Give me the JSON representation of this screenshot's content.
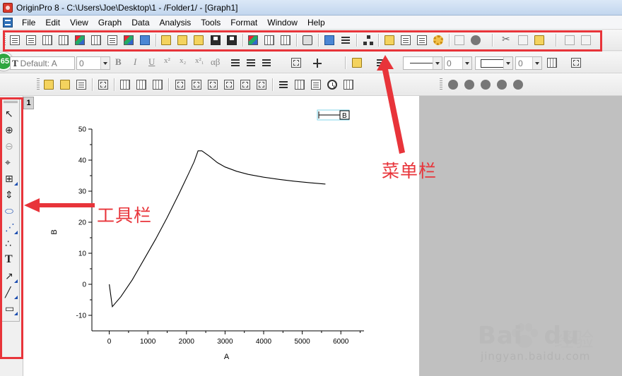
{
  "window": {
    "title": "OriginPro 8 - C:\\Users\\Joe\\Desktop\\1 - /Folder1/ - [Graph1]"
  },
  "menu": {
    "items": [
      "File",
      "Edit",
      "View",
      "Graph",
      "Data",
      "Analysis",
      "Tools",
      "Format",
      "Window",
      "Help"
    ]
  },
  "format_toolbar": {
    "font_name": "Default: A",
    "font_size": "0",
    "bold": "B",
    "italic": "I",
    "underline": "U",
    "superscript": "x²",
    "subscript": "x₂",
    "supersub": "x²₁",
    "greek": "αβ",
    "line_width": "0",
    "border_width": "0"
  },
  "badge": {
    "value": "65"
  },
  "graph": {
    "layer_number": "1",
    "legend_label": "B"
  },
  "annotations": {
    "menubar_label": "菜单栏",
    "toolbar_label": "工具栏"
  },
  "watermark": {
    "logo_text": "Bai",
    "logo_text2": "du",
    "cn_text": "经验",
    "url": "jingyan.baidu.com"
  },
  "chart_data": {
    "type": "line",
    "xlabel": "A",
    "ylabel": "B",
    "xlim": [
      -450,
      6600
    ],
    "ylim": [
      -15,
      50
    ],
    "xticks": [
      0,
      1000,
      2000,
      3000,
      4000,
      5000,
      6000
    ],
    "yticks": [
      -10,
      0,
      10,
      20,
      30,
      40,
      50
    ],
    "grid": false,
    "legend": "top-right",
    "series": [
      {
        "name": "B",
        "x": [
          0,
          80,
          300,
          600,
          900,
          1200,
          1500,
          1800,
          2050,
          2200,
          2300,
          2400,
          2600,
          2800,
          3000,
          3300,
          3600,
          4000,
          4400,
          4800,
          5200,
          5600
        ],
        "y": [
          0,
          -7.2,
          -4,
          1.5,
          8,
          14.5,
          21.5,
          29,
          35.5,
          39.5,
          43,
          43,
          41.2,
          39.2,
          37.8,
          36.4,
          35.4,
          34.5,
          33.8,
          33.2,
          32.7,
          32.3
        ]
      }
    ],
    "colors": {
      "line": "#000000"
    }
  }
}
